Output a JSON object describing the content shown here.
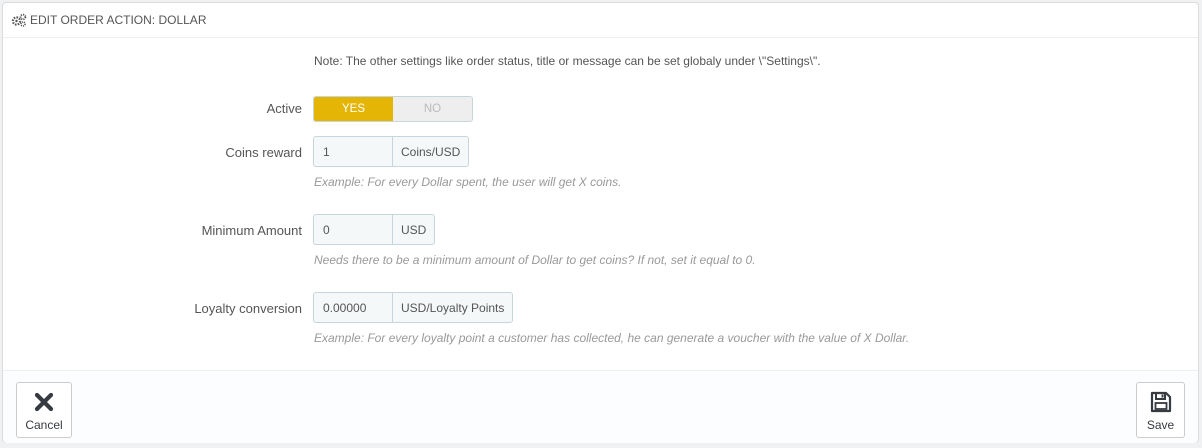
{
  "panel": {
    "title": "EDIT ORDER ACTION: DOLLAR",
    "note": "Note: The other settings like order status, title or message can be set globaly under \\\"Settings\\\"."
  },
  "form": {
    "active": {
      "label": "Active",
      "yes": "YES",
      "no": "NO",
      "value": "YES"
    },
    "coins_reward": {
      "label": "Coins reward",
      "value": "1",
      "unit": "Coins/USD",
      "help": "Example: For every Dollar spent, the user will get X coins."
    },
    "minimum_amount": {
      "label": "Minimum Amount",
      "value": "0",
      "unit": "USD",
      "help": "Needs there to be a minimum amount of Dollar to get coins? If not, set it equal to 0."
    },
    "loyalty_conversion": {
      "label": "Loyalty conversion",
      "value": "0.00000",
      "unit": "USD/Loyalty Points",
      "help": "Example: For every loyalty point a customer has collected, he can generate a voucher with the value of X Dollar."
    }
  },
  "footer": {
    "cancel_label": "Cancel",
    "save_label": "Save"
  },
  "icons": {
    "heading": "cogs-icon",
    "cancel": "close-icon",
    "save": "save-icon"
  },
  "colors": {
    "accent": "#e4b505"
  }
}
